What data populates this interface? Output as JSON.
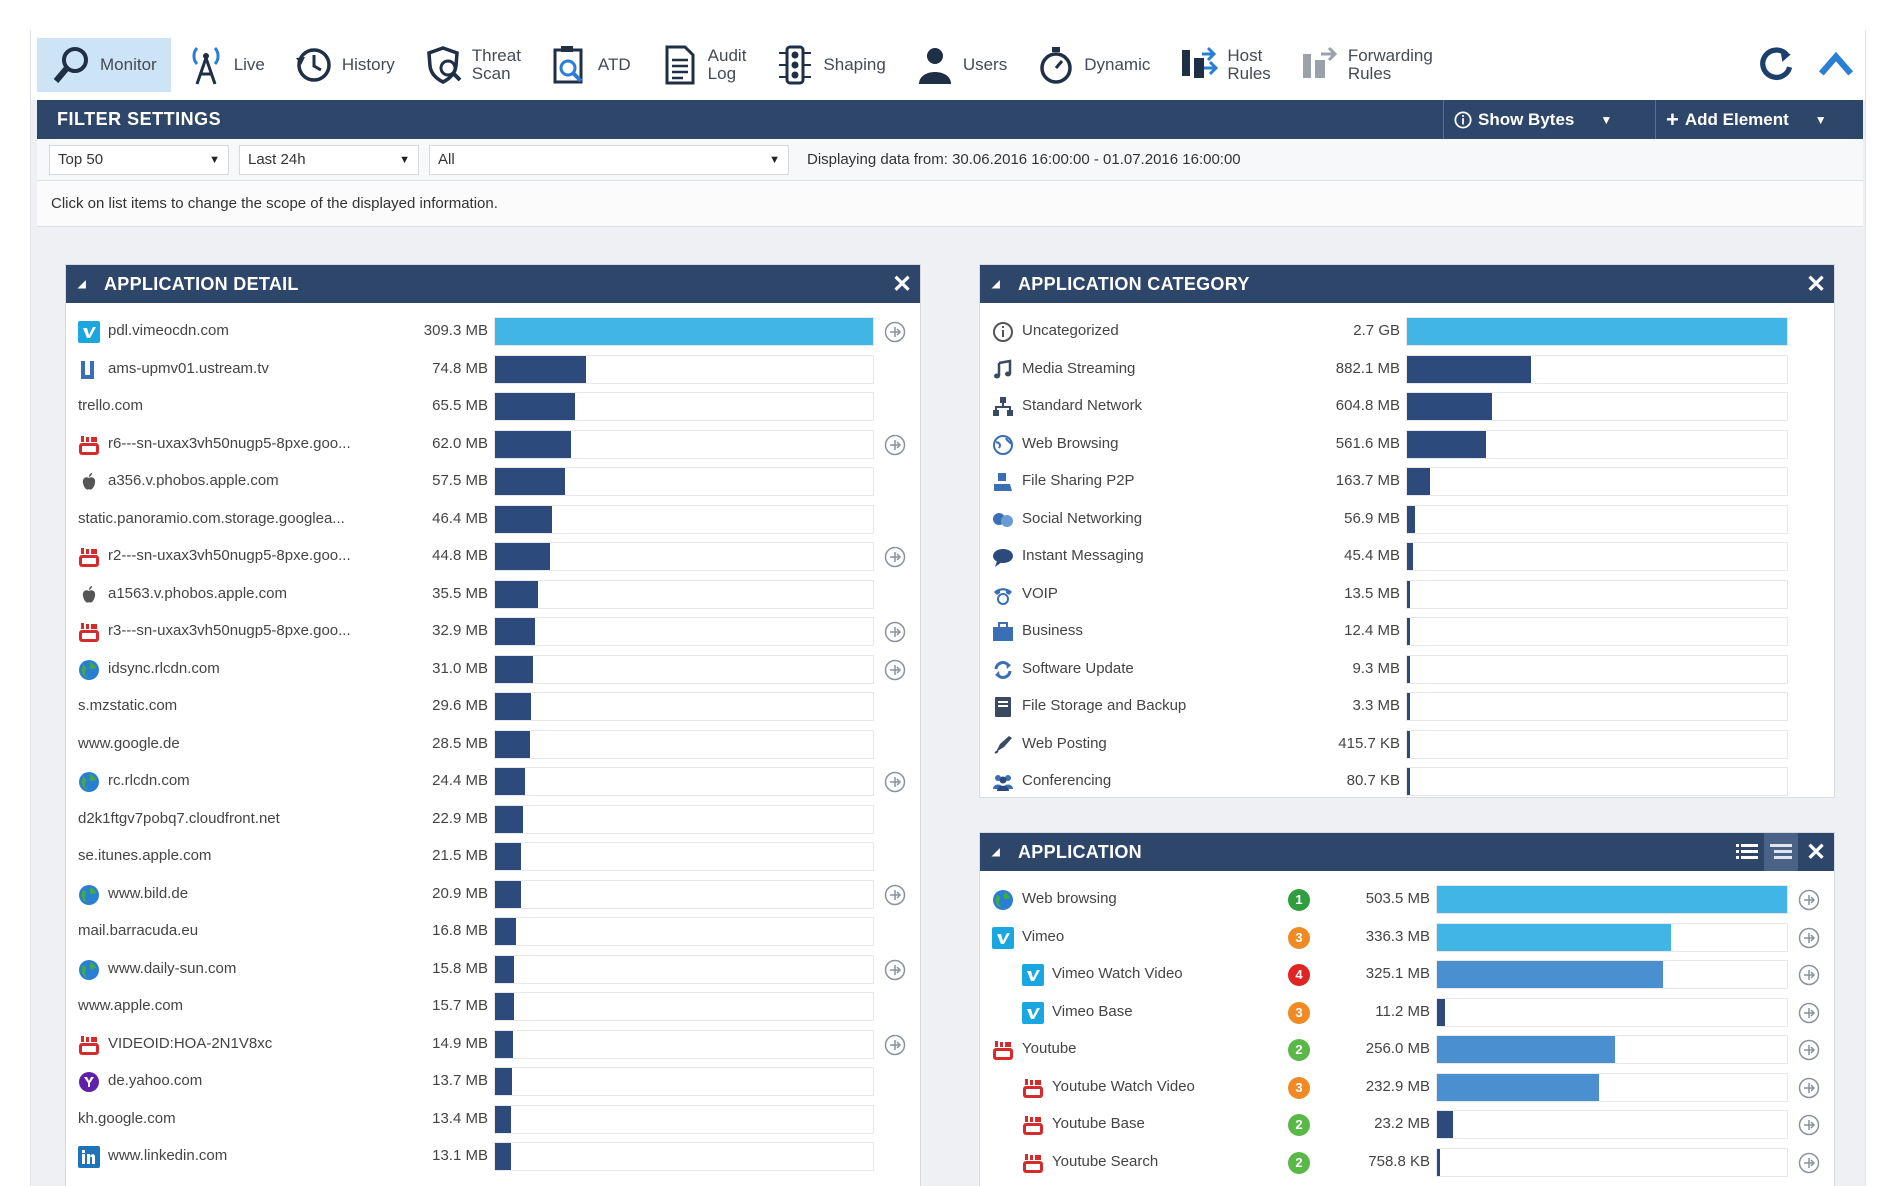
{
  "toolbar": {
    "items": [
      {
        "label": "Monitor",
        "icon": "magnifier-icon"
      },
      {
        "label": "Live",
        "icon": "antenna-icon"
      },
      {
        "label": "History",
        "icon": "clock-icon"
      },
      {
        "label": "Threat\nScan",
        "icon": "shield-scan-icon"
      },
      {
        "label": "ATD",
        "icon": "atd-icon"
      },
      {
        "label": "Audit\nLog",
        "icon": "document-icon"
      },
      {
        "label": "Shaping",
        "icon": "traffic-light-icon"
      },
      {
        "label": "Users",
        "icon": "user-icon"
      },
      {
        "label": "Dynamic",
        "icon": "stopwatch-icon"
      },
      {
        "label": "Host\nRules",
        "icon": "host-rules-icon"
      },
      {
        "label": "Forwarding\nRules",
        "icon": "forwarding-rules-icon"
      }
    ],
    "active_index": 0
  },
  "filter_bar": {
    "title": "FILTER SETTINGS",
    "show_bytes": "Show Bytes",
    "add_element": "Add Element"
  },
  "selects": {
    "top": "Top 50",
    "period": "Last 24h",
    "scope": "All",
    "range_text": "Displaying data from: 30.06.2016 16:00:00 - 01.07.2016 16:00:00"
  },
  "hint": "Click on list items to change the scope of the displayed information.",
  "app_detail": {
    "title": "APPLICATION DETAIL",
    "max_mb": 309.3,
    "rows": [
      {
        "name": "pdl.vimeocdn.com",
        "value": "309.3 MB",
        "mb": 309.3,
        "icon": "vimeo",
        "plus": true,
        "highlight": true
      },
      {
        "name": "ams-upmv01.ustream.tv",
        "value": "74.8 MB",
        "mb": 74.8,
        "icon": "ustream",
        "plus": false
      },
      {
        "name": "trello.com",
        "value": "65.5 MB",
        "mb": 65.5,
        "icon": "",
        "plus": false
      },
      {
        "name": "r6---sn-uxax3vh50nugp5-8pxe.goo...",
        "value": "62.0 MB",
        "mb": 62.0,
        "icon": "youtube",
        "plus": true
      },
      {
        "name": "a356.v.phobos.apple.com",
        "value": "57.5 MB",
        "mb": 57.5,
        "icon": "apple",
        "plus": false
      },
      {
        "name": "static.panoramio.com.storage.googlea...",
        "value": "46.4 MB",
        "mb": 46.4,
        "icon": "",
        "plus": false
      },
      {
        "name": "r2---sn-uxax3vh50nugp5-8pxe.goo...",
        "value": "44.8 MB",
        "mb": 44.8,
        "icon": "youtube",
        "plus": true
      },
      {
        "name": "a1563.v.phobos.apple.com",
        "value": "35.5 MB",
        "mb": 35.5,
        "icon": "apple",
        "plus": false
      },
      {
        "name": "r3---sn-uxax3vh50nugp5-8pxe.goo...",
        "value": "32.9 MB",
        "mb": 32.9,
        "icon": "youtube",
        "plus": true
      },
      {
        "name": "idsync.rlcdn.com",
        "value": "31.0 MB",
        "mb": 31.0,
        "icon": "globe",
        "plus": true
      },
      {
        "name": "s.mzstatic.com",
        "value": "29.6 MB",
        "mb": 29.6,
        "icon": "",
        "plus": false
      },
      {
        "name": "www.google.de",
        "value": "28.5 MB",
        "mb": 28.5,
        "icon": "",
        "plus": false
      },
      {
        "name": "rc.rlcdn.com",
        "value": "24.4 MB",
        "mb": 24.4,
        "icon": "globe",
        "plus": true
      },
      {
        "name": "d2k1ftgv7pobq7.cloudfront.net",
        "value": "22.9 MB",
        "mb": 22.9,
        "icon": "",
        "plus": false
      },
      {
        "name": "se.itunes.apple.com",
        "value": "21.5 MB",
        "mb": 21.5,
        "icon": "",
        "plus": false
      },
      {
        "name": "www.bild.de",
        "value": "20.9 MB",
        "mb": 20.9,
        "icon": "globe",
        "plus": true
      },
      {
        "name": "mail.barracuda.eu",
        "value": "16.8 MB",
        "mb": 16.8,
        "icon": "",
        "plus": false
      },
      {
        "name": "www.daily-sun.com",
        "value": "15.8 MB",
        "mb": 15.8,
        "icon": "globe",
        "plus": true
      },
      {
        "name": "www.apple.com",
        "value": "15.7 MB",
        "mb": 15.7,
        "icon": "",
        "plus": false
      },
      {
        "name": "VIDEOID:HOA-2N1V8xc",
        "value": "14.9 MB",
        "mb": 14.9,
        "icon": "youtube",
        "plus": true
      },
      {
        "name": "de.yahoo.com",
        "value": "13.7 MB",
        "mb": 13.7,
        "icon": "yahoo",
        "plus": false
      },
      {
        "name": "kh.google.com",
        "value": "13.4 MB",
        "mb": 13.4,
        "icon": "",
        "plus": false
      },
      {
        "name": "www.linkedin.com",
        "value": "13.1 MB",
        "mb": 13.1,
        "icon": "linkedin",
        "plus": false
      }
    ]
  },
  "app_category": {
    "title": "APPLICATION CATEGORY",
    "max_mb": 2700,
    "rows": [
      {
        "name": "Uncategorized",
        "value": "2.7 GB",
        "mb": 2700,
        "icon": "info",
        "highlight": true
      },
      {
        "name": "Media Streaming",
        "value": "882.1 MB",
        "mb": 882.1,
        "icon": "music"
      },
      {
        "name": "Standard Network",
        "value": "604.8 MB",
        "mb": 604.8,
        "icon": "network"
      },
      {
        "name": "Web Browsing",
        "value": "561.6 MB",
        "mb": 561.6,
        "icon": "browser"
      },
      {
        "name": "File Sharing P2P",
        "value": "163.7 MB",
        "mb": 163.7,
        "icon": "p2p"
      },
      {
        "name": "Social Networking",
        "value": "56.9 MB",
        "mb": 56.9,
        "icon": "social"
      },
      {
        "name": "Instant Messaging",
        "value": "45.4 MB",
        "mb": 45.4,
        "icon": "chat"
      },
      {
        "name": "VOIP",
        "value": "13.5 MB",
        "mb": 13.5,
        "icon": "phone"
      },
      {
        "name": "Business",
        "value": "12.4 MB",
        "mb": 12.4,
        "icon": "briefcase"
      },
      {
        "name": "Software Update",
        "value": "9.3 MB",
        "mb": 9.3,
        "icon": "update"
      },
      {
        "name": "File Storage and Backup",
        "value": "3.3 MB",
        "mb": 3.3,
        "icon": "storage"
      },
      {
        "name": "Web Posting",
        "value": "415.7 KB",
        "mb": 0.41,
        "icon": "pen"
      },
      {
        "name": "Conferencing",
        "value": "80.7 KB",
        "mb": 0.08,
        "icon": "group"
      }
    ]
  },
  "application": {
    "title": "APPLICATION",
    "max_mb": 503.5,
    "rows": [
      {
        "name": "Web browsing",
        "value": "503.5 MB",
        "mb": 503.5,
        "icon": "globe",
        "risk": "1",
        "risk_color": "#2e9e3e",
        "indent": 0,
        "style": "light"
      },
      {
        "name": "Vimeo",
        "value": "336.3 MB",
        "mb": 336.3,
        "icon": "vimeo",
        "risk": "3",
        "risk_color": "#f08a24",
        "indent": 0,
        "style": "light"
      },
      {
        "name": "Vimeo Watch Video",
        "value": "325.1 MB",
        "mb": 325.1,
        "icon": "vimeo",
        "risk": "4",
        "risk_color": "#e02424",
        "indent": 1,
        "style": "mid"
      },
      {
        "name": "Vimeo Base",
        "value": "11.2 MB",
        "mb": 11.2,
        "icon": "vimeo",
        "risk": "3",
        "risk_color": "#f08a24",
        "indent": 1,
        "style": "dark"
      },
      {
        "name": "Youtube",
        "value": "256.0 MB",
        "mb": 256.0,
        "icon": "youtube",
        "risk": "2",
        "risk_color": "#59b848",
        "indent": 0,
        "style": "mid"
      },
      {
        "name": "Youtube Watch Video",
        "value": "232.9 MB",
        "mb": 232.9,
        "icon": "youtube",
        "risk": "3",
        "risk_color": "#f08a24",
        "indent": 1,
        "style": "mid"
      },
      {
        "name": "Youtube Base",
        "value": "23.2 MB",
        "mb": 23.2,
        "icon": "youtube",
        "risk": "2",
        "risk_color": "#59b848",
        "indent": 1,
        "style": "dark"
      },
      {
        "name": "Youtube Search",
        "value": "758.8 KB",
        "mb": 0.74,
        "icon": "youtube",
        "risk": "2",
        "risk_color": "#59b848",
        "indent": 1,
        "style": "dark"
      }
    ]
  },
  "colors": {
    "header": "#2d4669",
    "bar_dark": "#2c4a7c",
    "bar_light": "#41b6e6",
    "bar_mid": "#4a8fd0",
    "active_tab": "#cde3f6"
  }
}
